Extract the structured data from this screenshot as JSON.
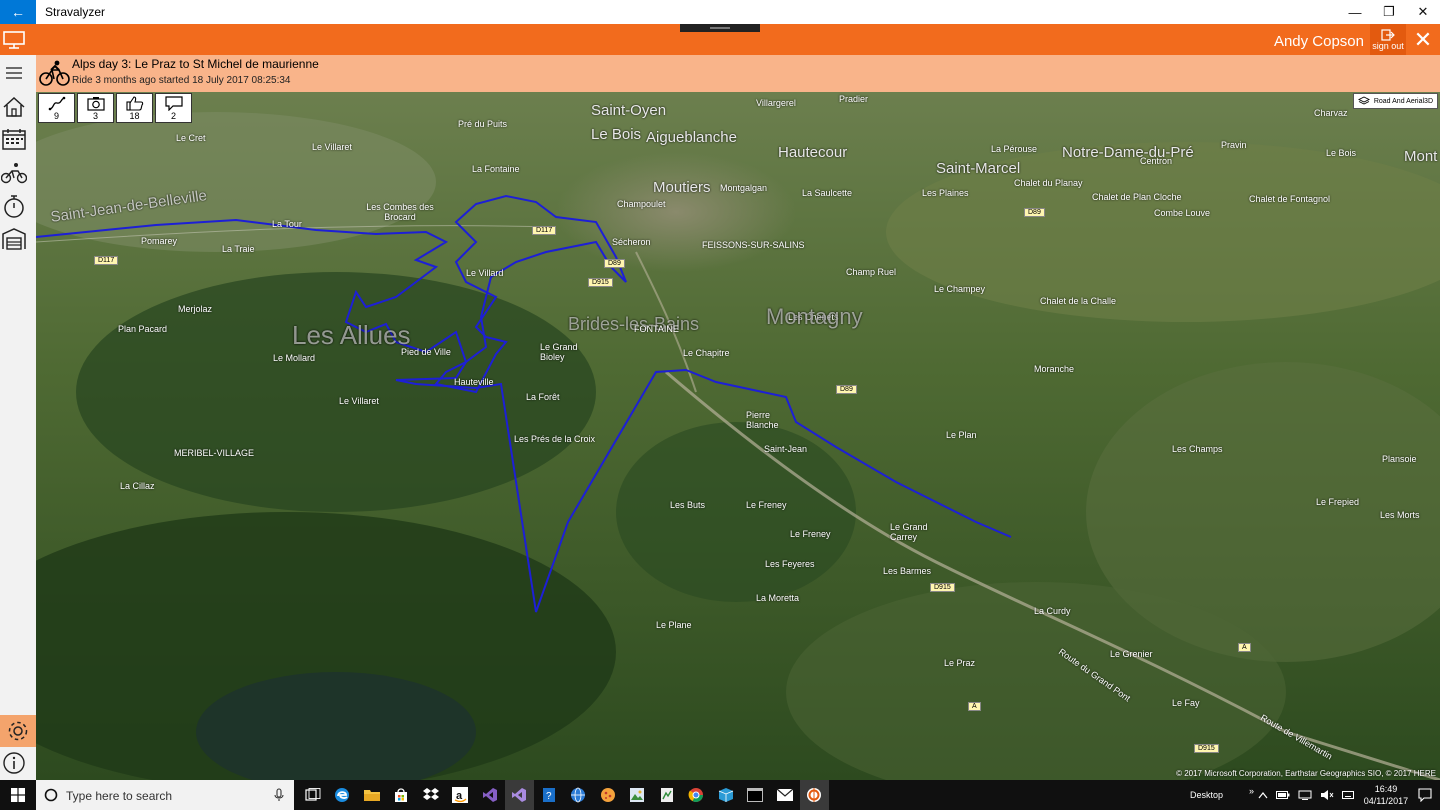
{
  "window": {
    "title": "Stravalyzer",
    "back_glyph": "←",
    "min_glyph": "—",
    "restore_glyph": "❐",
    "close_glyph": "✕"
  },
  "header": {
    "user_name": "Andy Copson",
    "signout_label": "sign out",
    "close_glyph": "✕",
    "accent": "#f26b1d"
  },
  "activity": {
    "title": "Alps day 3: Le Praz to St Michel de maurienne",
    "subtitle": "Ride 3 months ago started 18 July 2017 08:25:34",
    "stats": [
      {
        "icon": "route-icon",
        "value": "9"
      },
      {
        "icon": "camera-icon",
        "value": "3"
      },
      {
        "icon": "thumbs-up-icon",
        "value": "18"
      },
      {
        "icon": "comment-icon",
        "value": "2"
      }
    ]
  },
  "nav": {
    "items": [
      "hamburger-icon",
      "home-icon",
      "calendar-icon",
      "cyclist-icon",
      "stopwatch-icon",
      "garage-icon"
    ],
    "footer": [
      "gear-icon",
      "info-icon"
    ]
  },
  "map": {
    "style_label": "Road And Aerial3D",
    "copyright": "© 2017 Microsoft Corporation, Earthstar Geographics  SIO, © 2017 HERE",
    "route_color": "#1d1fd6",
    "places": [
      "Saint-Oyen",
      "Villargerel",
      "Pradier",
      "Charvaz",
      "Pré du Puits",
      "Le Bois",
      "Aigueblanche",
      "La Pérouse",
      "Pravin",
      "Le Cret",
      "Le Villaret",
      "Hautecour",
      "Saint-Marcel",
      "Notre-Dame-du-Pré",
      "Le Bois",
      "Centron",
      "Mont",
      "La Fontaine",
      "Moutiers",
      "Montgalgan",
      "Chalet du Planay",
      "Chalet de Plan Cloche",
      "Chalet de Fontagnol",
      "Les Plaines",
      "La Saulcette",
      "Champoulet",
      "Les Combes des Brocard",
      "La Tour",
      "Combe Louve",
      "Pomarey",
      "La Traie",
      "Sécheron",
      "FEISSONS-SUR-SALINS",
      "Le Villard",
      "Champ Ruel",
      "Le Champey",
      "Chalet de la Challe",
      "Merjolaz",
      "Les Chenets",
      "Plan Pacard",
      "Brides-les-Bains",
      "Montagny",
      "FONTAINE",
      "Le Mollard",
      "Pied de Ville",
      "Le Grand Bioley",
      "Le Chapitre",
      "Moranche",
      "Hauteville",
      "La Forêt",
      "Le Villaret",
      "Pierre Blanche",
      "Le Plan",
      "Les Allues",
      "Les Prés de la Croix",
      "Saint-Jean",
      "Les Champs",
      "Plansoie",
      "La Cillaz",
      "MERIBEL-VILLAGE",
      "Le Frepied",
      "Les Buts",
      "Le Freney",
      "Les Morts",
      "Le Freney",
      "Le Grand Carrey",
      "Les Feyeres",
      "Les Barmes",
      "La Moretta",
      "Le Plane",
      "La Curdy",
      "Le Grenier",
      "Route du Grand Pont",
      "Le Praz",
      "Le Fay",
      "Route de Villemartin",
      "Saint-Jean-de-Belleville"
    ],
    "roads": [
      "D117",
      "D117",
      "D89",
      "D915",
      "D89",
      "D89",
      "D915",
      "A",
      "A",
      "D915"
    ]
  },
  "taskbar": {
    "search_placeholder": "Type here to search",
    "apps": [
      "task-view-icon",
      "edge-icon",
      "file-explorer-icon",
      "store-icon",
      "dropbox-icon",
      "amazon-icon",
      "visual-studio-icon",
      "visual-studio-preview-icon",
      "azure-icon",
      "web-browser-icon",
      "pizza-icon",
      "photo-viewer-icon",
      "spreadsheet-icon",
      "chrome-icon",
      "box-icon",
      "console-icon",
      "mail-icon",
      "stravalyzer-icon"
    ],
    "desktop_label": "Desktop",
    "tray_chevron": "»",
    "time": "16:49",
    "date": "04/11/2017"
  }
}
